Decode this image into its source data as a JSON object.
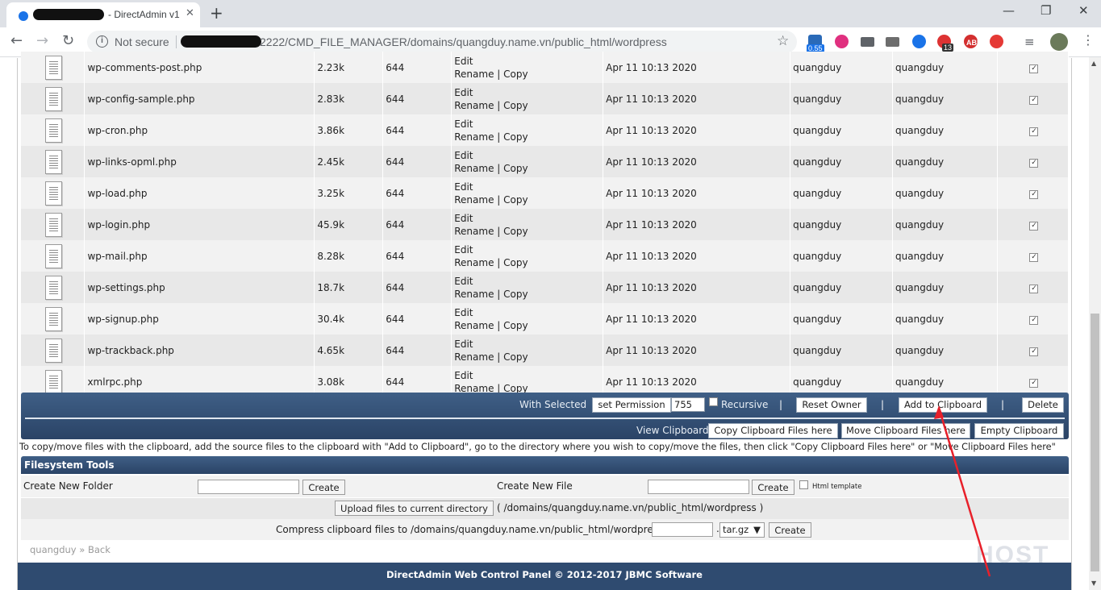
{
  "browser": {
    "tab_title": "- DirectAdmin v1",
    "not_secure": "Not secure",
    "url": "2222/CMD_FILE_MANAGER/domains/quangduy.name.vn/public_html/wordpress",
    "ext_badge_1": "0.55",
    "ext_badge_2": "13",
    "ext_badge_3": "ABP"
  },
  "files": [
    {
      "name": "wp-comments-post.php",
      "size": "2.23k",
      "perm": "644",
      "edit": "Edit",
      "rename": "Rename",
      "copy": "Copy",
      "date": "Apr 11 10:13 2020",
      "owner": "quangduy",
      "group": "quangduy"
    },
    {
      "name": "wp-config-sample.php",
      "size": "2.83k",
      "perm": "644",
      "edit": "Edit",
      "rename": "Rename",
      "copy": "Copy",
      "date": "Apr 11 10:13 2020",
      "owner": "quangduy",
      "group": "quangduy"
    },
    {
      "name": "wp-cron.php",
      "size": "3.86k",
      "perm": "644",
      "edit": "Edit",
      "rename": "Rename",
      "copy": "Copy",
      "date": "Apr 11 10:13 2020",
      "owner": "quangduy",
      "group": "quangduy"
    },
    {
      "name": "wp-links-opml.php",
      "size": "2.45k",
      "perm": "644",
      "edit": "Edit",
      "rename": "Rename",
      "copy": "Copy",
      "date": "Apr 11 10:13 2020",
      "owner": "quangduy",
      "group": "quangduy"
    },
    {
      "name": "wp-load.php",
      "size": "3.25k",
      "perm": "644",
      "edit": "Edit",
      "rename": "Rename",
      "copy": "Copy",
      "date": "Apr 11 10:13 2020",
      "owner": "quangduy",
      "group": "quangduy"
    },
    {
      "name": "wp-login.php",
      "size": "45.9k",
      "perm": "644",
      "edit": "Edit",
      "rename": "Rename",
      "copy": "Copy",
      "date": "Apr 11 10:13 2020",
      "owner": "quangduy",
      "group": "quangduy"
    },
    {
      "name": "wp-mail.php",
      "size": "8.28k",
      "perm": "644",
      "edit": "Edit",
      "rename": "Rename",
      "copy": "Copy",
      "date": "Apr 11 10:13 2020",
      "owner": "quangduy",
      "group": "quangduy"
    },
    {
      "name": "wp-settings.php",
      "size": "18.7k",
      "perm": "644",
      "edit": "Edit",
      "rename": "Rename",
      "copy": "Copy",
      "date": "Apr 11 10:13 2020",
      "owner": "quangduy",
      "group": "quangduy"
    },
    {
      "name": "wp-signup.php",
      "size": "30.4k",
      "perm": "644",
      "edit": "Edit",
      "rename": "Rename",
      "copy": "Copy",
      "date": "Apr 11 10:13 2020",
      "owner": "quangduy",
      "group": "quangduy"
    },
    {
      "name": "wp-trackback.php",
      "size": "4.65k",
      "perm": "644",
      "edit": "Edit",
      "rename": "Rename",
      "copy": "Copy",
      "date": "Apr 11 10:13 2020",
      "owner": "quangduy",
      "group": "quangduy"
    },
    {
      "name": "xmlrpc.php",
      "size": "3.08k",
      "perm": "644",
      "edit": "Edit",
      "rename": "Rename",
      "copy": "Copy",
      "date": "Apr 11 10:13 2020",
      "owner": "quangduy",
      "group": "quangduy"
    }
  ],
  "with_selected": {
    "label": "With Selected",
    "set_permission": "set Permission",
    "permission_value": "755",
    "recursive": "Recursive",
    "reset_owner": "Reset Owner",
    "add_to_clipboard": "Add to Clipboard",
    "delete": "Delete",
    "view_clipboard": "View Clipboard",
    "copy_here": "Copy Clipboard Files here",
    "move_here": "Move Clipboard Files here",
    "empty_clipboard": "Empty Clipboard"
  },
  "help_text": "To copy/move files with the clipboard, add the source files to the clipboard with \"Add to Clipboard\", go to the directory where you wish to copy/move the files, then click \"Copy Clipboard Files here\" or \"Move Clipboard Files here\"",
  "filesystem_tools": {
    "title": "Filesystem Tools",
    "create_folder": "Create New Folder",
    "create_file": "Create New File",
    "create_btn": "Create",
    "html_template": "Html template",
    "upload_btn": "Upload files to current directory",
    "upload_path": "( /domains/quangduy.name.vn/public_html/wordpress )",
    "compress_label": "Compress clipboard files to /domains/quangduy.name.vn/public_html/wordpress/",
    "compress_ext": "tar.gz",
    "dot": "."
  },
  "breadcrumb": {
    "user": "quangduy",
    "sep": "»",
    "back": "Back"
  },
  "footer": "DirectAdmin Web Control Panel © 2012-2017 JBMC Software",
  "watermark": "HOST",
  "colors": {
    "bar": "#2f4b70",
    "annotation_arrow": "#e8202a"
  }
}
